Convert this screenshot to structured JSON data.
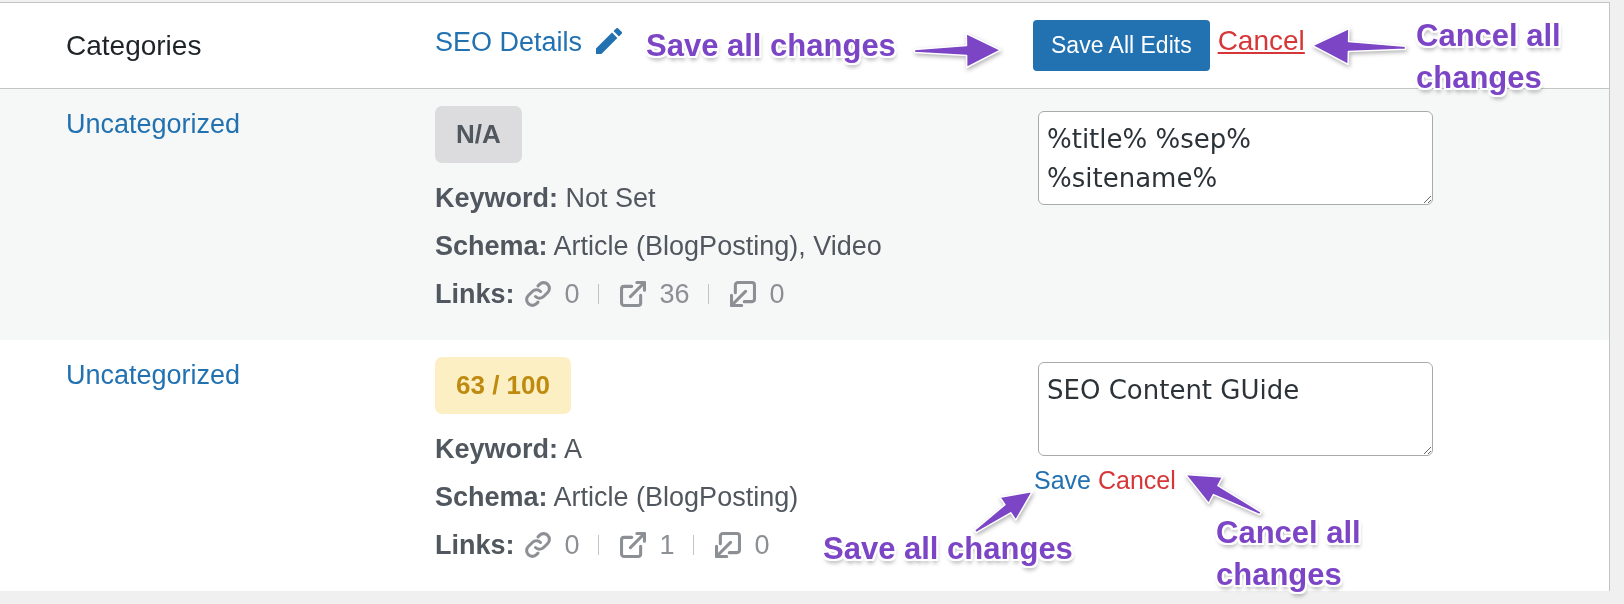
{
  "table": {
    "columns": [
      {
        "label": "Categories",
        "kind": "plain"
      },
      {
        "label": "SEO Details",
        "kind": "editable"
      }
    ],
    "bulk_edit": {
      "save_button": "Save All Edits",
      "cancel_link": "Cancel"
    },
    "rows": [
      {
        "category": "Uncategorized",
        "score": {
          "kind": "none",
          "text": "N/A"
        },
        "keyword": "**Keyword:** Not Set",
        "schema": "**Schema:** Article (BlogPosting), Video",
        "links_label": "Links:",
        "links": [
          {
            "kind": "internal",
            "count": "0"
          },
          {
            "kind": "external",
            "count": "36"
          },
          {
            "kind": "incoming",
            "count": "0"
          }
        ],
        "title_field": {
          "value": "%title% %sep% %sitename%"
        }
      },
      {
        "category": "Uncategorized",
        "score": {
          "kind": "average",
          "text": "63 / 100"
        },
        "keyword": "**Keyword:** A",
        "schema": "**Schema:** Article (BlogPosting)",
        "links_label": "Links:",
        "links": [
          {
            "kind": "internal",
            "count": "0"
          },
          {
            "kind": "external",
            "count": "1"
          },
          {
            "kind": "incoming",
            "count": "0"
          }
        ],
        "title_field": {
          "value": "SEO Content GUide"
        },
        "row_actions": {
          "save_link": "Save",
          "cancel_link": "Cancel"
        }
      }
    ]
  },
  "annotations": [
    {
      "text": "Save all changes"
    },
    {
      "text": "Cancel all changes"
    },
    {
      "text": "Save all changes"
    },
    {
      "text": "Cancel all changes"
    }
  ]
}
